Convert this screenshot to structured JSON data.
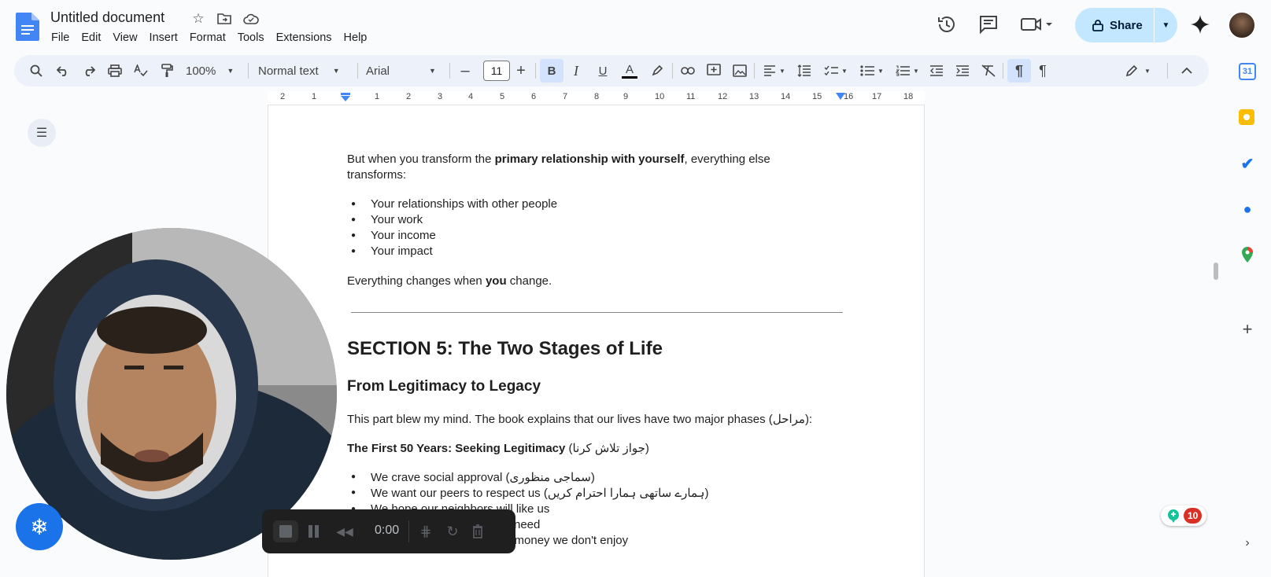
{
  "header": {
    "title": "Untitled document",
    "menu": [
      "File",
      "Edit",
      "View",
      "Insert",
      "Format",
      "Tools",
      "Extensions",
      "Help"
    ],
    "share_label": "Share"
  },
  "toolbar": {
    "zoom": "100%",
    "style": "Normal text",
    "font": "Arial",
    "font_size": "11"
  },
  "ruler": {
    "ticks": [
      "2",
      "1",
      "1",
      "2",
      "3",
      "4",
      "5",
      "6",
      "7",
      "8",
      "9",
      "10",
      "11",
      "12",
      "13",
      "14",
      "15",
      "16",
      "17",
      "18"
    ]
  },
  "document": {
    "p1_a": "But when you transform the ",
    "p1_bold": "primary relationship with yourself",
    "p1_b": ", everything else",
    "p1_c": "transforms:",
    "bullets1": [
      "Your relationships with other people",
      "Your work",
      "Your income",
      "Your impact"
    ],
    "p2_a": "Everything changes when ",
    "p2_bold": "you",
    "p2_b": " change.",
    "section_title": "SECTION 5: The Two Stages of Life",
    "sub_title": "From Legitimacy to Legacy",
    "p3": "This part blew my mind. The book explains that our lives have two major phases (مراحل):",
    "p4_bold": "The First 50 Years: Seeking Legitimacy",
    "p4_rest": " (جواز تلاش کرنا)",
    "bullets2": [
      "We crave social approval (سماجی منظوری)",
      "We want our peers to respect us (ہمارے ساتھی ہمارا احترام کریں)",
      "We hope our neighbors will like us",
      "need",
      "g money we don't enjoy"
    ]
  },
  "recorder": {
    "time": "0:00"
  },
  "notifications": {
    "count": "10"
  },
  "colors": {
    "accent": "#1a73e8",
    "share_bg": "#c2e7ff",
    "toolbar_bg": "#edf2fa",
    "badge_red": "#d93025"
  }
}
